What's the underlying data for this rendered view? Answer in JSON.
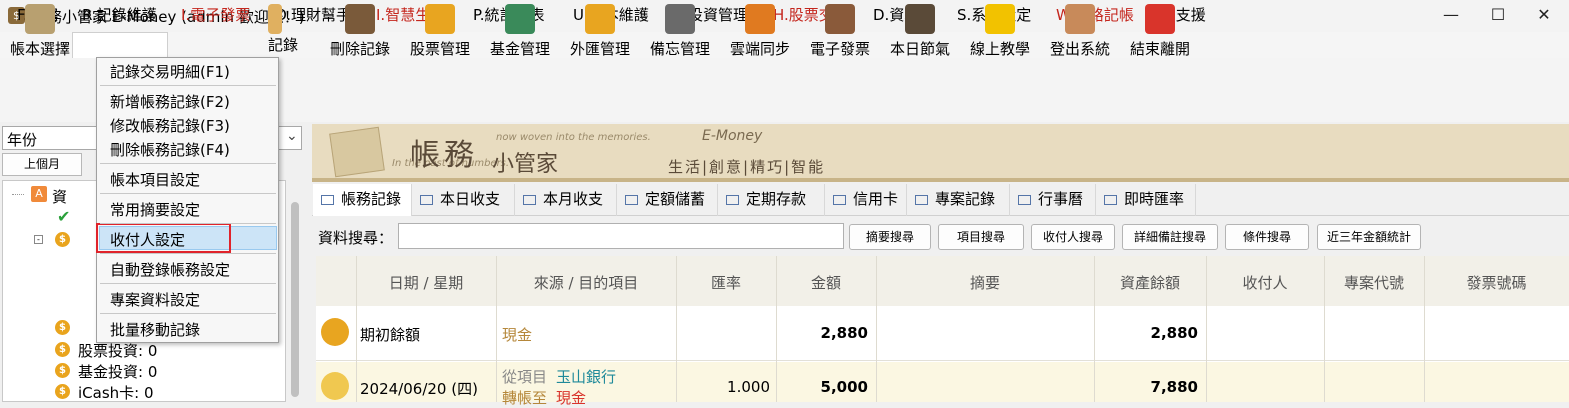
{
  "window": {
    "title": "帳務小管家 E-Money (admin 歡迎您！)",
    "min": "—",
    "max": "☐",
    "close": "✕"
  },
  "menubar": [
    {
      "label": "F.檔案",
      "red": false
    },
    {
      "label": "R.記錄維護",
      "red": false
    },
    {
      "label": "I.電子發票",
      "red": true
    },
    {
      "label": "O.理財幫手",
      "red": false
    },
    {
      "label": "I.智慧生活",
      "red": true
    },
    {
      "label": "P.統計報表",
      "red": false
    },
    {
      "label": "U.帳本維護",
      "red": false
    },
    {
      "label": "B.投資管理",
      "red": false
    },
    {
      "label": "H.股票交易",
      "red": true
    },
    {
      "label": "D.資料庫",
      "red": false
    },
    {
      "label": "S.系統設定",
      "red": false
    },
    {
      "label": "W.網路記帳",
      "red": true
    },
    {
      "label": "A.支援",
      "red": false
    }
  ],
  "toolbar": {
    "first": "帳本選擇",
    "partial": "記錄",
    "items": [
      "刪除記錄",
      "股票管理",
      "基金管理",
      "外匯管理",
      "備忘管理",
      "雲端同步",
      "電子發票",
      "本日節氣",
      "線上教學",
      "登出系統",
      "結束離開"
    ],
    "icon_colors": [
      "#7a5a3a",
      "#e8a520",
      "#3a8a5a",
      "#e8a520",
      "#6a6a6a",
      "#e07a20",
      "#8a5a3a",
      "#5a4a38",
      "#f2c200",
      "#c88a5a",
      "#d9342b"
    ]
  },
  "left": {
    "year_label": "年份",
    "prev_month": "上個月",
    "tree_root": "資",
    "tree": [
      {
        "text": "股票投資: 0"
      },
      {
        "text": "基金投資: 0"
      },
      {
        "text": "iCash卡: 0"
      }
    ]
  },
  "dropdown": {
    "items": [
      "記錄交易明細(F1)",
      "新增帳務記錄(F2)",
      "修改帳務記錄(F3)",
      "刪除帳務記錄(F4)",
      "帳本項目設定",
      "常用摘要設定",
      "收付人設定",
      "自動登錄帳務設定",
      "專案資料設定",
      "批量移動記錄"
    ]
  },
  "banner": {
    "title": "帳務",
    "subtitle": "小管家",
    "tagline1": "now woven into the memories.",
    "tagline2": "In the past of numbers.",
    "brand": "E-Money",
    "slogan": "生活|創意|精巧|智能"
  },
  "tabs": [
    "帳務記錄",
    "本日收支",
    "本月收支",
    "定額儲蓄",
    "定期存款",
    "信用卡",
    "專案記錄",
    "行事曆",
    "即時匯率"
  ],
  "search": {
    "label": "資料搜尋：",
    "value": "",
    "buttons": [
      "摘要搜尋",
      "項目搜尋",
      "收付人搜尋",
      "詳細備註搜尋",
      "條件搜尋",
      "近三年金額統計"
    ]
  },
  "grid": {
    "headers": [
      "日期 / 星期",
      "來源 / 目的項目",
      "匯率",
      "金額",
      "摘要",
      "資產餘額",
      "收付人",
      "專案代號",
      "發票號碼"
    ],
    "rows": [
      {
        "date": "期初餘額",
        "source": "現金",
        "rate": "",
        "amount": "2,880",
        "balance": "2,880"
      },
      {
        "date": "2024/06/20 (四)",
        "from_label": "從項目",
        "from": "玉山銀行",
        "to_label": "轉帳至",
        "to": "現金",
        "rate": "1.000",
        "amount": "5,000",
        "balance": "7,880"
      }
    ]
  },
  "colors": {
    "accent_red": "#c4261d",
    "highlight_border": "#e0232b",
    "link_blue": "#1f8a9a",
    "source_gold": "#b5873a"
  }
}
